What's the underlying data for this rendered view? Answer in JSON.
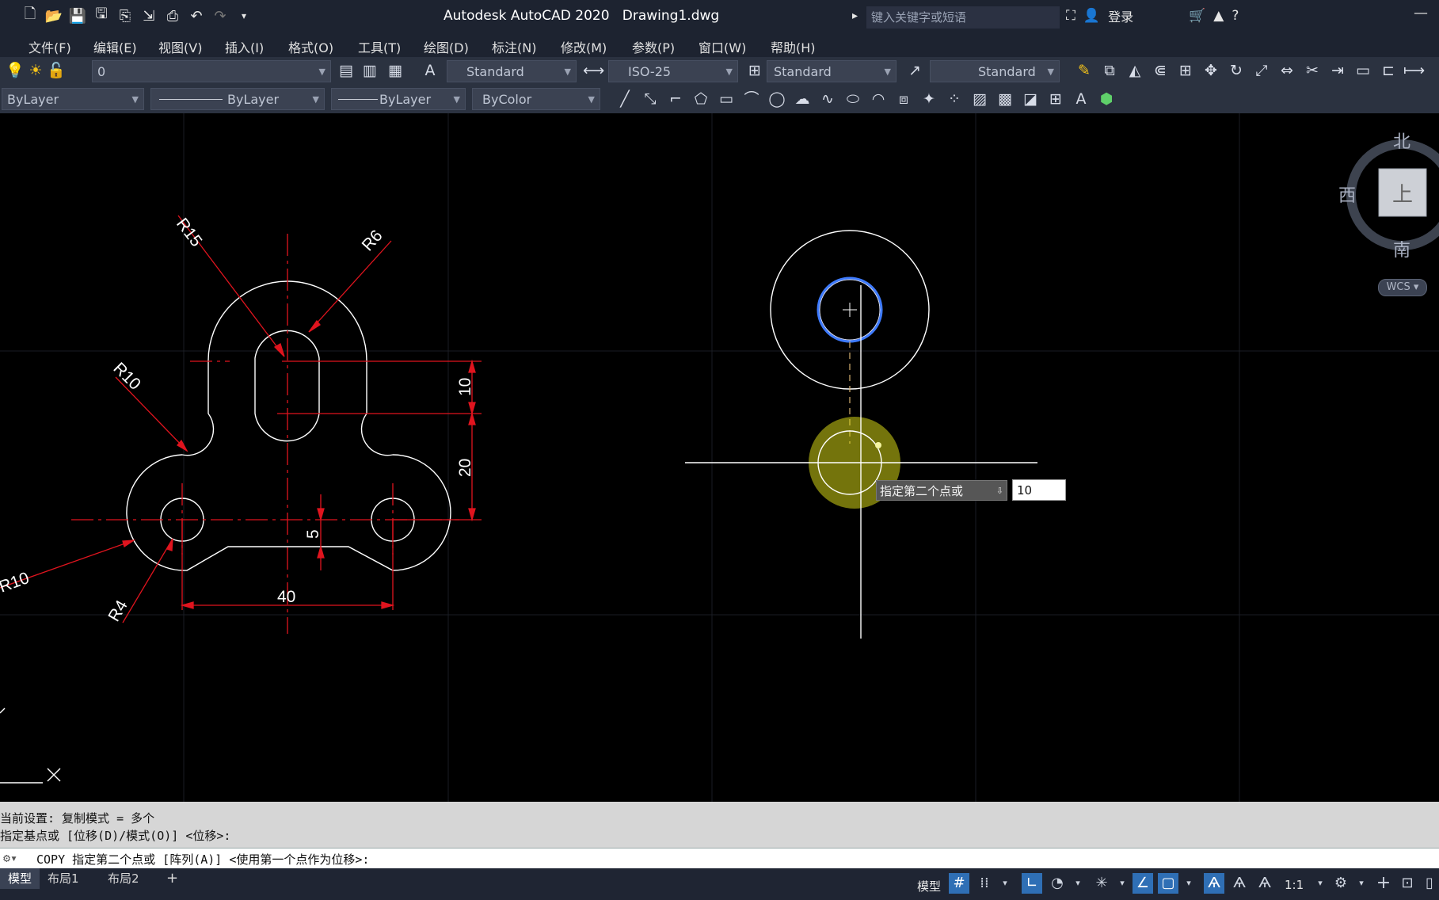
{
  "titlebar": {
    "app_name": "Autodesk AutoCAD 2020",
    "file_name": "Drawing1.dwg",
    "search_placeholder": "键入关键字或短语",
    "login_label": "登录"
  },
  "menu": [
    "文件(F)",
    "编辑(E)",
    "视图(V)",
    "插入(I)",
    "格式(O)",
    "工具(T)",
    "绘图(D)",
    "标注(N)",
    "修改(M)",
    "参数(P)",
    "窗口(W)",
    "帮助(H)"
  ],
  "toolbar1": {
    "layer": "0",
    "text_style": "Standard",
    "dim_style": "ISO-25",
    "table_style": "Standard",
    "multileader_style": "Standard"
  },
  "toolbar2": {
    "color": "ByLayer",
    "linetype": "ByLayer",
    "lineweight": "ByLayer",
    "plot_style": "ByColor"
  },
  "drawing": {
    "labels": {
      "r15": "R15",
      "r6": "R6",
      "r10_top": "R10",
      "r10_bottom": "R10",
      "r4": "R4",
      "d10": "10",
      "d20": "20",
      "d5": "5",
      "d40": "40"
    }
  },
  "viewcube": {
    "north": "北",
    "south": "南",
    "west": "西",
    "face": "上",
    "wcs": "WCS"
  },
  "tooltip": {
    "prompt": "指定第二个点或",
    "value": "10"
  },
  "command": {
    "history_1": "当前设置:  复制模式 = 多个",
    "history_2": "指定基点或 [位移(D)/模式(O)] <位移>:",
    "current": "COPY 指定第二个点或 [阵列(A)] <使用第一个点作为位移>:"
  },
  "tabs": [
    "模型",
    "布局1",
    "布局2"
  ],
  "status": {
    "model_label": "模型",
    "scale": "1:1"
  },
  "colors": {
    "dimension": "#e0141e",
    "geometry": "#ffffff",
    "highlight": "#d4d415",
    "selected_circle": "#3e7bff"
  }
}
